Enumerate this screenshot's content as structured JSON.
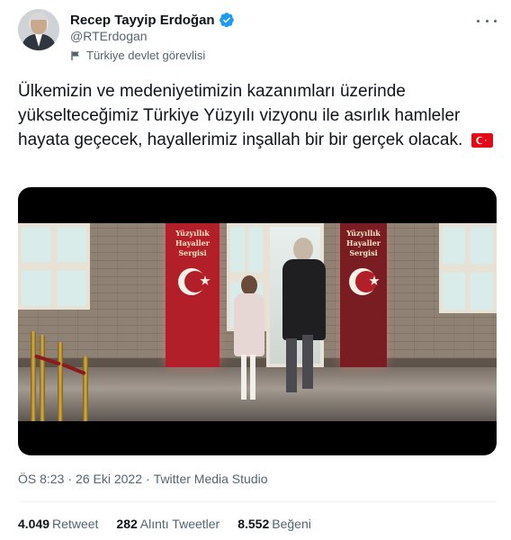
{
  "author": {
    "display_name": "Recep Tayyip Erdoğan",
    "handle": "@RTErdogan",
    "label": "Türkiye devlet görevlisi"
  },
  "tweet": {
    "text": "Ülkemizin ve medeniyetimizin kazanımları üzerinde yükselteceğimiz Türkiye Yüzyılı vizyonu ile asırlık hamleler hayata geçecek, hayallerimiz inşallah bir bir gerçek olacak."
  },
  "media": {
    "banner_text": "Yüzyıllık Hayaller Sergisi"
  },
  "meta": {
    "time": "ÖS 8:23",
    "date": "26 Eki 2022",
    "separator": "·",
    "source": "Twitter Media Studio"
  },
  "stats": {
    "retweets_count": "4.049",
    "retweets_label": "Retweet",
    "quotes_count": "282",
    "quotes_label": "Alıntı Tweetler",
    "likes_count": "8.552",
    "likes_label": "Beğeni"
  },
  "colors": {
    "verified": "#1d9bf0",
    "text_primary": "#0f1419",
    "text_secondary": "#536471",
    "turkish_red": "#e30a17"
  }
}
